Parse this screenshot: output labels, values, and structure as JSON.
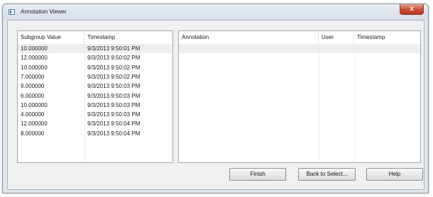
{
  "window": {
    "title": "Annotation Viewer",
    "close_glyph": "x"
  },
  "subgroup_list": {
    "columns": [
      "Subgroup Value",
      "Timestamp"
    ],
    "rows": [
      {
        "value": "10.000000",
        "timestamp": "9/3/2013 9:50:01 PM"
      },
      {
        "value": "12.000000",
        "timestamp": "9/3/2013 9:50:02 PM"
      },
      {
        "value": "10.000000",
        "timestamp": "9/3/2013 9:50:02 PM"
      },
      {
        "value": "7.000000",
        "timestamp": "9/3/2013 9:50:02 PM"
      },
      {
        "value": "9.000000",
        "timestamp": "9/3/2013 9:50:03 PM"
      },
      {
        "value": "6.000000",
        "timestamp": "9/3/2013 9:50:03 PM"
      },
      {
        "value": "10.000000",
        "timestamp": "9/3/2013 9:50:03 PM"
      },
      {
        "value": "4.000000",
        "timestamp": "9/3/2013 9:50:03 PM"
      },
      {
        "value": "12.000000",
        "timestamp": "9/3/2013 9:50:04 PM"
      },
      {
        "value": "8.000000",
        "timestamp": "9/3/2013 9:50:04 PM"
      }
    ]
  },
  "annotation_list": {
    "columns": [
      "Annotation",
      "User",
      "Timestamp"
    ],
    "rows": []
  },
  "buttons": {
    "finish": "Finish",
    "back": "Back to Select...",
    "help": "Help"
  },
  "icons": {
    "app": "app-window-icon",
    "close": "close-icon"
  },
  "colors": {
    "close_button": "#c94a30",
    "selected_row": "#eeeeee"
  }
}
